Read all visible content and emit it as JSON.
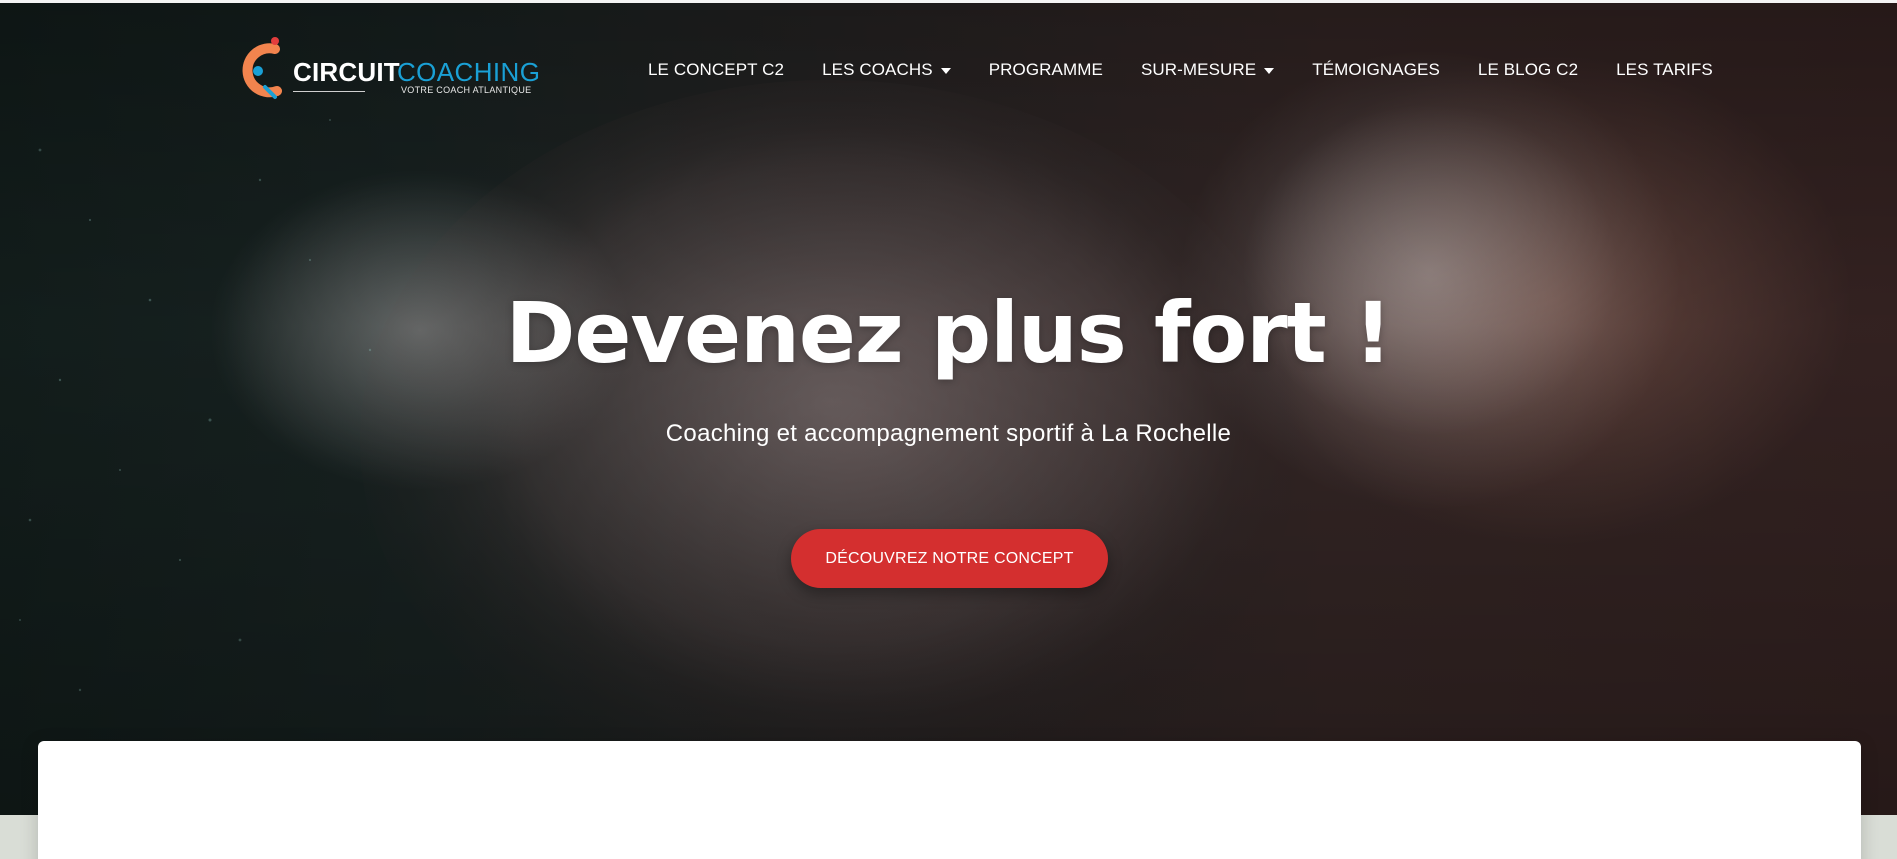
{
  "brand": {
    "name_main": "CIRCUIT",
    "name_accent": "COACHING",
    "tagline": "VOTRE COACH ATLANTIQUE",
    "accent_color": "#1aa0d5",
    "mark_color": "#f2844e",
    "mark_dot_color": "#e23d3d"
  },
  "nav": {
    "items": [
      {
        "label": "LE CONCEPT C2",
        "has_dropdown": false
      },
      {
        "label": "LES COACHS",
        "has_dropdown": true
      },
      {
        "label": "PROGRAMME",
        "has_dropdown": false
      },
      {
        "label": "SUR-MESURE",
        "has_dropdown": true
      },
      {
        "label": "TÉMOIGNAGES",
        "has_dropdown": false
      },
      {
        "label": "LE BLOG C2",
        "has_dropdown": false
      },
      {
        "label": "LES TARIFS",
        "has_dropdown": false
      }
    ]
  },
  "hero": {
    "title": "Devenez plus fort !",
    "subtitle": "Coaching et accompagnement sportif à La Rochelle",
    "cta_label": "DÉCOUVREZ NOTRE CONCEPT",
    "cta_color": "#d42f2f"
  }
}
